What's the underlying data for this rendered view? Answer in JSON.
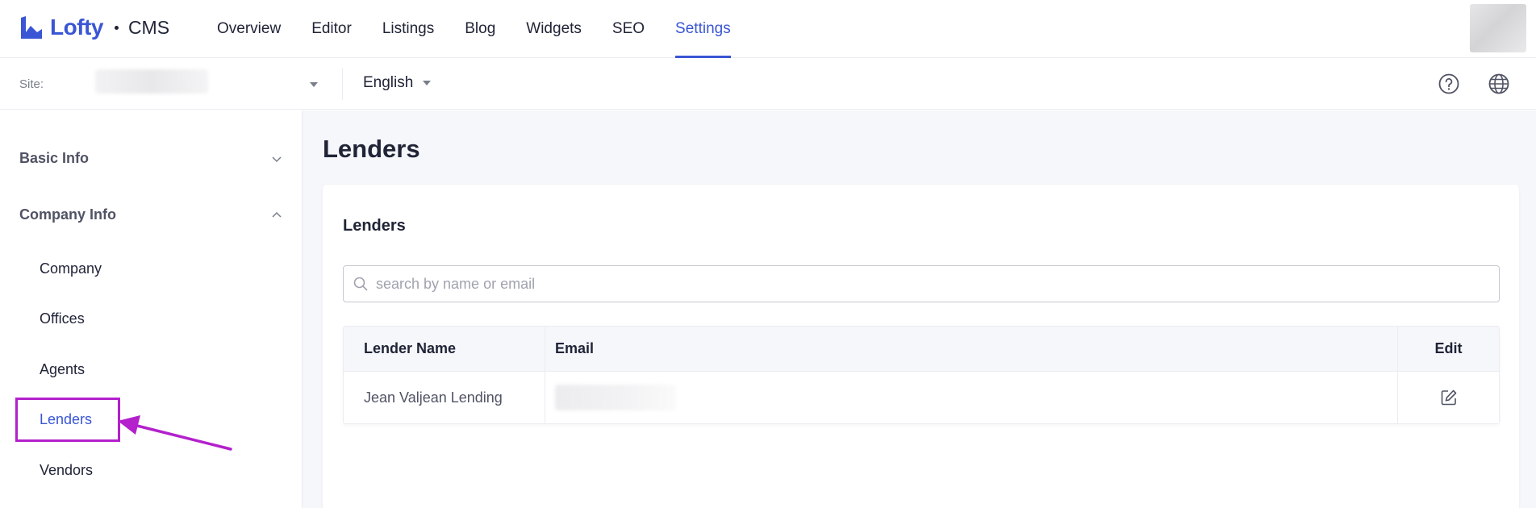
{
  "header": {
    "brand": "Lofty",
    "product": "CMS",
    "tabs": [
      {
        "label": "Overview"
      },
      {
        "label": "Editor"
      },
      {
        "label": "Listings"
      },
      {
        "label": "Blog"
      },
      {
        "label": "Widgets"
      },
      {
        "label": "SEO"
      },
      {
        "label": "Settings",
        "active": true
      }
    ],
    "accent_color": "#3a56d4"
  },
  "subbar": {
    "site_label": "Site:",
    "language": "English",
    "icons": [
      "help-icon",
      "globe-icon"
    ]
  },
  "sidebar": {
    "groups": [
      {
        "label": "Basic Info",
        "expanded": false
      },
      {
        "label": "Company Info",
        "expanded": true
      }
    ],
    "items": [
      {
        "label": "Company"
      },
      {
        "label": "Offices"
      },
      {
        "label": "Agents"
      },
      {
        "label": "Lenders",
        "active": true
      },
      {
        "label": "Vendors"
      }
    ],
    "annotation_color": "#b320cc"
  },
  "main": {
    "page_title": "Lenders",
    "card_title": "Lenders",
    "search_placeholder": "search by name or email",
    "search_value": "",
    "table": {
      "columns": [
        "Lender Name",
        "Email",
        "Edit"
      ],
      "rows": [
        {
          "name": "Jean Valjean Lending"
        }
      ]
    }
  }
}
